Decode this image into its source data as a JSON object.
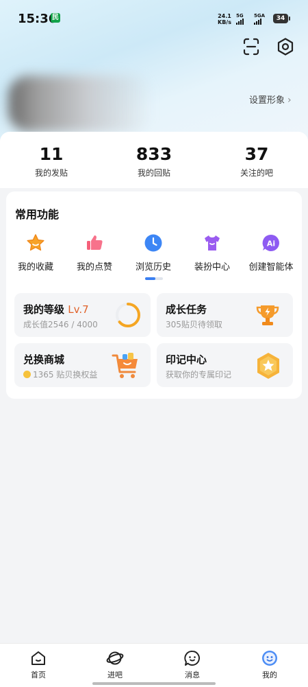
{
  "status_bar": {
    "time": "15:36",
    "app_badge": "民",
    "net_speed_value": "24.1",
    "net_speed_unit": "KB/s",
    "sim1": "5G",
    "sim2": "5GA",
    "battery": "34"
  },
  "profile": {
    "set_image_label": "设置形象"
  },
  "stats": [
    {
      "value": "11",
      "label": "我的发贴"
    },
    {
      "value": "833",
      "label": "我的回贴"
    },
    {
      "value": "37",
      "label": "关注的吧"
    }
  ],
  "common_functions": {
    "title": "常用功能",
    "items": [
      {
        "label": "我的收藏",
        "icon": "star-icon"
      },
      {
        "label": "我的点赞",
        "icon": "thumbs-up-icon"
      },
      {
        "label": "浏览历史",
        "icon": "clock-icon"
      },
      {
        "label": "装扮中心",
        "icon": "shirt-icon"
      },
      {
        "label": "创建智能体",
        "icon": "ai-chat-icon"
      }
    ]
  },
  "tiles": {
    "level": {
      "title": "我的等级",
      "level": "Lv.7",
      "subtitle": "成长值2546 / 4000",
      "progress": 0.64
    },
    "growth": {
      "title": "成长任务",
      "subtitle": "305贴贝待领取"
    },
    "exchange": {
      "title": "兑换商城",
      "subtitle": "1365 贴贝换权益"
    },
    "marks": {
      "title": "印记中心",
      "subtitle": "获取你的专属印记"
    }
  },
  "bottom_nav": [
    {
      "label": "首页",
      "icon": "home-icon"
    },
    {
      "label": "进吧",
      "icon": "planet-icon"
    },
    {
      "label": "消息",
      "icon": "message-icon"
    },
    {
      "label": "我的",
      "icon": "profile-face-icon",
      "active": true
    }
  ],
  "colors": {
    "accent": "#3a7ff2",
    "level": "#e0622a",
    "progress": "#f5a623"
  }
}
